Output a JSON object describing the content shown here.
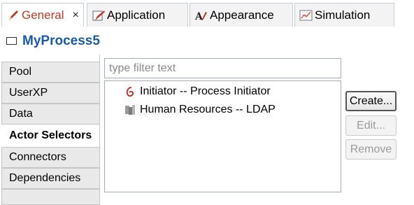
{
  "tabs": [
    {
      "label": "General",
      "icon": "pen-icon",
      "active": true,
      "closable": true
    },
    {
      "label": "Application",
      "icon": "form-icon"
    },
    {
      "label": "Appearance",
      "icon": "appearance-icon"
    },
    {
      "label": "Simulation",
      "icon": "chart-icon"
    }
  ],
  "tab_close_glyph": "×",
  "header": {
    "title": "MyProcess5",
    "icon": "process-icon"
  },
  "sidebar": {
    "items": [
      {
        "label": "Pool"
      },
      {
        "label": "UserXP"
      },
      {
        "label": "Data"
      },
      {
        "label": "Actor Selectors",
        "active": true
      },
      {
        "label": "Connectors"
      },
      {
        "label": "Dependencies"
      }
    ]
  },
  "filter": {
    "placeholder": "type filter text",
    "value": ""
  },
  "actor_selectors": [
    {
      "label": "Initiator -- Process Initiator",
      "icon": "initiator-icon"
    },
    {
      "label": "Human Resources -- LDAP",
      "icon": "ldap-icon"
    }
  ],
  "buttons": {
    "create": "Create...",
    "edit": "Edit...",
    "remove": "Remove"
  },
  "colors": {
    "active_tab_text": "#c0392b",
    "title": "#1a5aa6"
  }
}
